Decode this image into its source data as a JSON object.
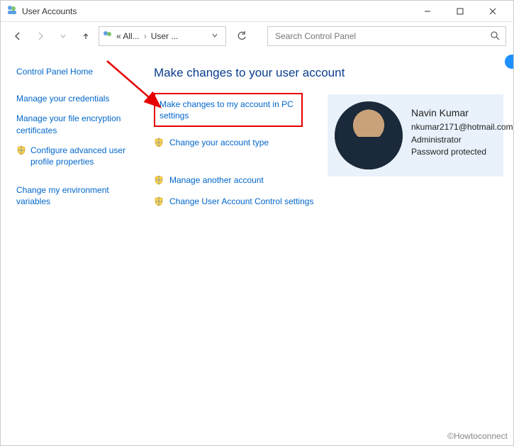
{
  "window": {
    "title": "User Accounts"
  },
  "breadcrumb": {
    "left": "« All...",
    "right": "User ..."
  },
  "search": {
    "placeholder": "Search Control Panel"
  },
  "sidebar": {
    "home": "Control Panel Home",
    "items": [
      "Manage your credentials",
      "Manage your file encryption certificates",
      "Configure advanced user profile properties",
      "Change my environment variables"
    ]
  },
  "main": {
    "heading": "Make changes to your user account",
    "link_pc_settings": "Make changes to my account in PC settings",
    "link_change_type": "Change your account type",
    "link_manage_another": "Manage another account",
    "link_uac": "Change User Account Control settings"
  },
  "account": {
    "name": "Navin Kumar",
    "email": "nkumar2171@hotmail.com",
    "role": "Administrator",
    "protected": "Password protected"
  },
  "footer": {
    "credit": "©Howtoconnect"
  }
}
